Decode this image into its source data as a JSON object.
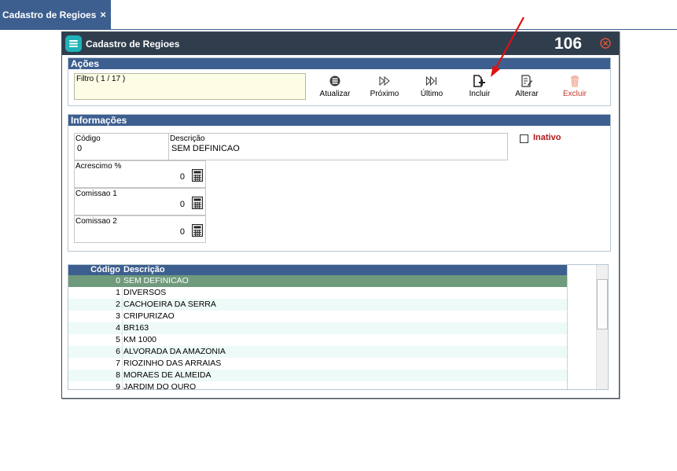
{
  "tab": {
    "title": "Cadastro de Regioes",
    "close": "×"
  },
  "window": {
    "title": "Cadastro de Regioes",
    "number": "106"
  },
  "acoes": {
    "header": "Ações",
    "filter": "Filtro ( 1 / 17 )",
    "buttons": [
      {
        "label": "Atualizar",
        "icon": "refresh-icon"
      },
      {
        "label": "Próximo",
        "icon": "next-icon"
      },
      {
        "label": "Último",
        "icon": "last-icon"
      },
      {
        "label": "Incluir",
        "icon": "add-document-icon"
      },
      {
        "label": "Alterar",
        "icon": "edit-icon"
      },
      {
        "label": "Excluir",
        "icon": "trash-icon"
      }
    ]
  },
  "informacoes": {
    "header": "Informações",
    "codigo_label": "Código",
    "codigo_value": "0",
    "descricao_label": "Descrição",
    "descricao_value": "SEM DEFINICAO",
    "inativo_label": "Inativo",
    "acrescimo_label": "Acrescimo %",
    "acrescimo_value": "0",
    "comissao1_label": "Comissao 1",
    "comissao1_value": "0",
    "comissao2_label": "Comissao 2",
    "comissao2_value": "0"
  },
  "grid": {
    "headers": {
      "codigo": "Código",
      "descricao": "Descrição"
    },
    "rows": [
      {
        "codigo": "0",
        "descricao": "SEM DEFINICAO"
      },
      {
        "codigo": "1",
        "descricao": "DIVERSOS"
      },
      {
        "codigo": "2",
        "descricao": "CACHOEIRA DA SERRA"
      },
      {
        "codigo": "3",
        "descricao": "CRIPURIZAO"
      },
      {
        "codigo": "4",
        "descricao": "BR163"
      },
      {
        "codigo": "5",
        "descricao": "KM 1000"
      },
      {
        "codigo": "6",
        "descricao": "ALVORADA DA AMAZONIA"
      },
      {
        "codigo": "7",
        "descricao": "RIOZINHO DAS ARRAIAS"
      },
      {
        "codigo": "8",
        "descricao": "MORAES DE ALMEIDA"
      },
      {
        "codigo": "9",
        "descricao": "JARDIM DO OURO"
      }
    ]
  },
  "colors": {
    "accent": "#3d5f8f",
    "selected_row": "#6f9a7c",
    "alt_row": "#eefaf8",
    "inativo": "#b11818",
    "excluir": "#c0392b",
    "annotation_arrow": "#e01010"
  }
}
